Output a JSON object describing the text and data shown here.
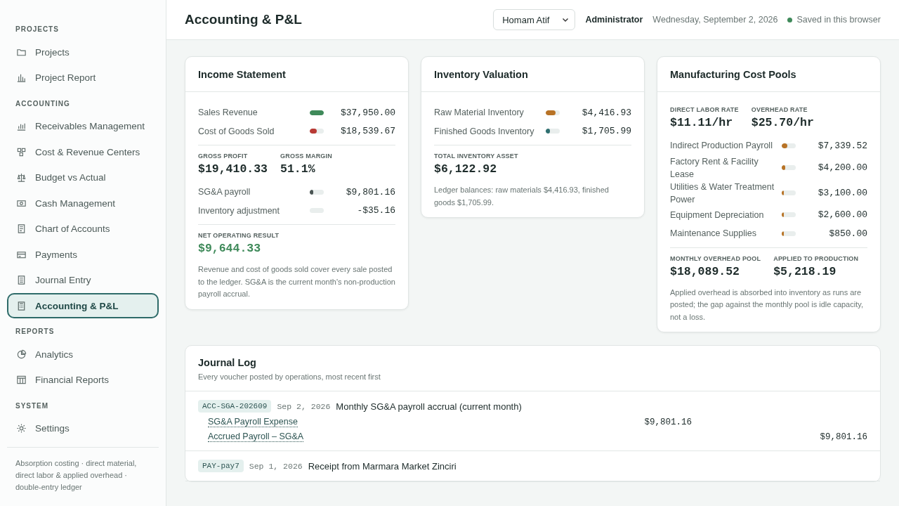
{
  "header": {
    "title": "Accounting & P&L",
    "user_select": {
      "value": "Homam Atif"
    },
    "role": "Administrator",
    "date": "Wednesday, September 2, 2026",
    "status": {
      "label": "Saved in this browser",
      "color": "#3f8a5a"
    }
  },
  "sidebar": {
    "sections": [
      {
        "heading": "PROJECTS",
        "items": [
          {
            "label": "Projects",
            "selected": false
          },
          {
            "label": "Project Report",
            "selected": false
          }
        ]
      },
      {
        "heading": "ACCOUNTING",
        "items": [
          {
            "label": "Receivables Management",
            "selected": false
          },
          {
            "label": "Cost & Revenue Centers",
            "selected": false
          },
          {
            "label": "Budget vs Actual",
            "selected": false
          },
          {
            "label": "Cash Management",
            "selected": false
          },
          {
            "label": "Chart of Accounts",
            "selected": false
          },
          {
            "label": "Payments",
            "selected": false
          },
          {
            "label": "Journal Entry",
            "selected": false
          },
          {
            "label": "Accounting & P&L",
            "selected": true
          }
        ]
      },
      {
        "heading": "REPORTS",
        "items": [
          {
            "label": "Analytics",
            "selected": false
          },
          {
            "label": "Financial Reports",
            "selected": false
          }
        ]
      },
      {
        "heading": "SYSTEM",
        "items": [
          {
            "label": "Settings",
            "selected": false
          }
        ]
      }
    ],
    "footer": "Absorption costing · direct material, direct labor & applied overhead · double-entry ledger"
  },
  "cards": [
    {
      "title": "Income Statement",
      "groups": [
        [
          {
            "kind": "bars",
            "rows": [
              {
                "label": "Sales Revenue",
                "level": 1,
                "color": "#3f8a5a",
                "amount": "$37,950.00"
              },
              {
                "label": "Cost of Goods Sold",
                "level": 0.49,
                "color": "#b83a35",
                "amount": "$18,539.67"
              }
            ]
          }
        ],
        [
          {
            "kind": "metrics",
            "items": [
              {
                "label": "GROSS PROFIT",
                "value": "$19,410.33"
              },
              {
                "label": "GROSS MARGIN",
                "value": "51.1%"
              }
            ]
          },
          {
            "kind": "bars",
            "rows": [
              {
                "label": "SG&A payroll",
                "level": 0.26,
                "color": "#4a5553",
                "amount": "$9,801.16"
              },
              {
                "label": "Inventory adjustment",
                "amount": "-$35.16"
              }
            ]
          }
        ],
        [
          {
            "kind": "metrics",
            "items": [
              {
                "label": "NET OPERATING RESULT",
                "value": "$9,644.33",
                "color": "#3f8a5a"
              }
            ]
          },
          {
            "kind": "note",
            "text": "Revenue and cost of goods sold cover every sale posted to the ledger. SG&A is the current month's non-production payroll accrual."
          }
        ]
      ]
    },
    {
      "title": "Inventory Valuation",
      "groups": [
        [
          {
            "kind": "bars",
            "rows": [
              {
                "label": "Raw Material Inventory",
                "level": 0.72,
                "color": "#b87326",
                "amount": "$4,416.93"
              },
              {
                "label": "Finished Goods Inventory",
                "level": 0.28,
                "color": "#2f6f70",
                "amount": "$1,705.99"
              }
            ]
          }
        ],
        [
          {
            "kind": "metrics",
            "items": [
              {
                "label": "TOTAL INVENTORY ASSET",
                "value": "$6,122.92"
              }
            ]
          },
          {
            "kind": "note",
            "text": "Ledger balances: raw materials $4,416.93, finished goods $1,705.99."
          }
        ]
      ]
    },
    {
      "title": "Manufacturing Cost Pools",
      "groups": [
        [
          {
            "kind": "metrics",
            "items": [
              {
                "label": "DIRECT LABOR RATE",
                "value": "$11.11/hr"
              },
              {
                "label": "OVERHEAD RATE",
                "value": "$25.70/hr"
              }
            ]
          },
          {
            "kind": "bars",
            "rows": [
              {
                "label": "Indirect Production Payroll",
                "level": 0.41,
                "color": "#b87326",
                "amount": "$7,339.52"
              },
              {
                "label": "Factory Rent & Facility Lease",
                "level": 0.23,
                "color": "#b87326",
                "amount": "$4,200.00"
              },
              {
                "label": "Utilities & Water Treatment Power",
                "level": 0.17,
                "color": "#b87326",
                "amount": "$3,100.00"
              },
              {
                "label": "Equipment Depreciation",
                "level": 0.14,
                "color": "#b87326",
                "amount": "$2,600.00"
              },
              {
                "label": "Maintenance Supplies",
                "level": 0.05,
                "color": "#b87326",
                "amount": "$850.00"
              }
            ]
          }
        ],
        [
          {
            "kind": "metrics",
            "items": [
              {
                "label": "MONTHLY OVERHEAD POOL",
                "value": "$18,089.52"
              },
              {
                "label": "APPLIED TO PRODUCTION",
                "value": "$5,218.19"
              }
            ]
          },
          {
            "kind": "note",
            "text": "Applied overhead is absorbed into inventory as runs are posted; the gap against the monthly pool is idle capacity, not a loss."
          }
        ]
      ]
    }
  ],
  "journal": {
    "title": "Journal Log",
    "subtitle": "Every voucher posted by operations, most recent first",
    "entries": [
      {
        "ref": "ACC-SGA-202609",
        "date": "Sep 2, 2026",
        "description": "Monthly SG&A payroll accrual (current month)",
        "lines": [
          {
            "account": "SG&A Payroll Expense",
            "debit": "$9,801.16"
          },
          {
            "account": "Accrued Payroll – SG&A",
            "credit": "$9,801.16"
          }
        ]
      },
      {
        "ref": "PAY-pay7",
        "date": "Sep 1, 2026",
        "description": "Receipt from Marmara Market Zinciri"
      }
    ]
  }
}
